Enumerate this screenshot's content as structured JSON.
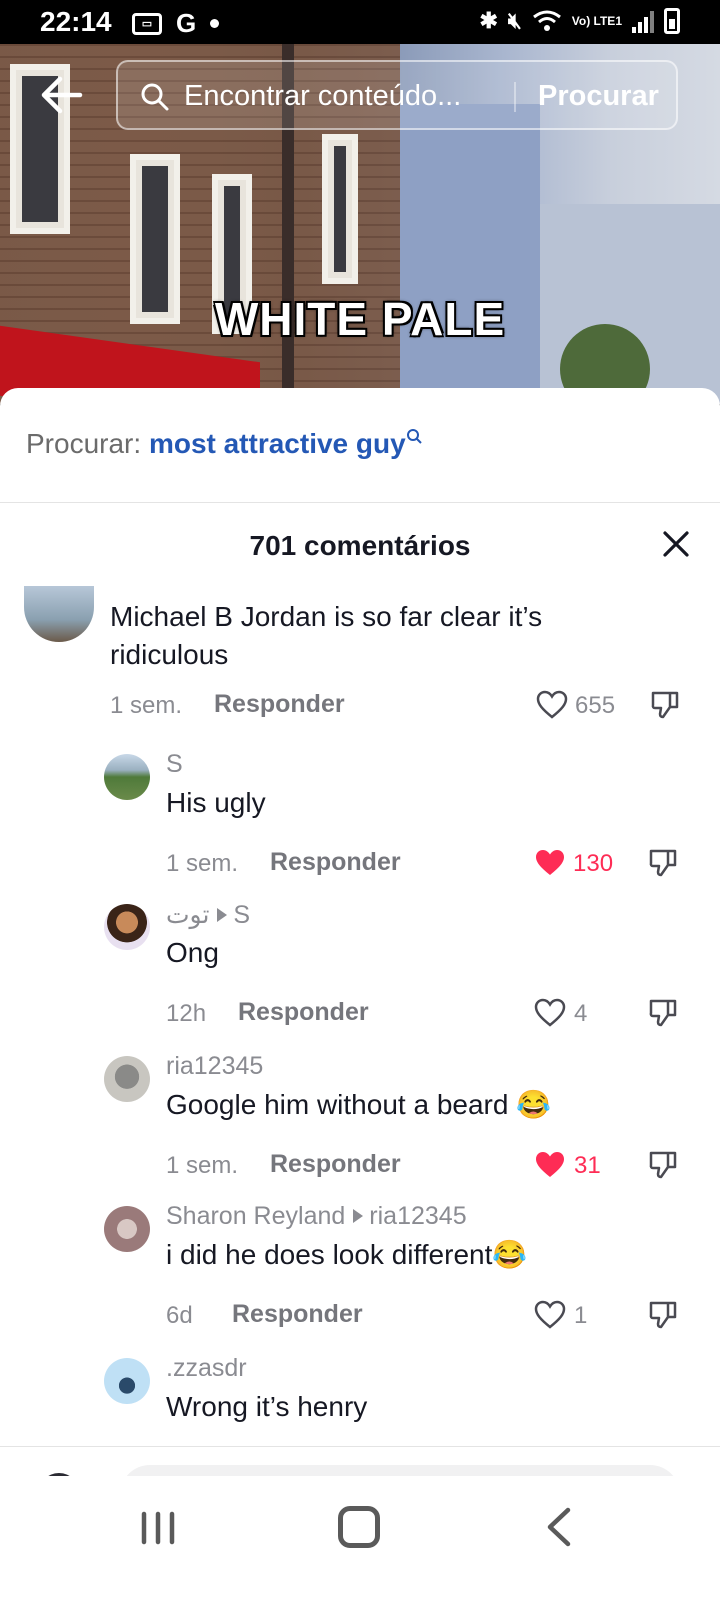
{
  "status_bar": {
    "time": "22:14",
    "left_icons": [
      "sim-icon",
      "G",
      "dot"
    ],
    "right_icons": [
      "bluetooth-icon",
      "mute-icon",
      "wifi-icon",
      "Vo) LTE1",
      "signal-icon",
      "battery-icon"
    ],
    "lte_label": "Vo) LTE1",
    "g_label": "G"
  },
  "search": {
    "placeholder": "Encontrar conteúdo...",
    "button_label": "Procurar"
  },
  "video": {
    "caption": "WHITE PALE"
  },
  "related_search": {
    "prefix": "Procurar:",
    "query": "most attractive guy"
  },
  "comments_header": {
    "count_label": "701 comentários"
  },
  "comments": [
    {
      "username": "",
      "text": "Michael B Jordan is so far clear it’s ridiculous",
      "time": "1 sem.",
      "reply_label": "Responder",
      "likes": "655",
      "liked": false
    },
    {
      "username": "S",
      "reply_to": "",
      "text": "His ugly",
      "time": "1 sem.",
      "reply_label": "Responder",
      "likes": "130",
      "liked": true
    },
    {
      "username": "توت",
      "reply_to": "S",
      "text": "Ong",
      "time": "12h",
      "reply_label": "Responder",
      "likes": "4",
      "liked": false
    },
    {
      "username": "ria12345",
      "reply_to": "",
      "text": "Google him without a beard 😂",
      "time": "1 sem.",
      "reply_label": "Responder",
      "likes": "31",
      "liked": true
    },
    {
      "username": "Sharon Reyland",
      "reply_to": "ria12345",
      "text": "i did he does look different😂",
      "time": "6d",
      "reply_label": "Responder",
      "likes": "1",
      "liked": false
    },
    {
      "username": ".zzasdr",
      "reply_to": "",
      "text": "Wrong it’s henry"
    }
  ],
  "colors": {
    "accent_link": "#2458b5",
    "liked": "#fe2c55",
    "muted": "#8a8b91"
  }
}
